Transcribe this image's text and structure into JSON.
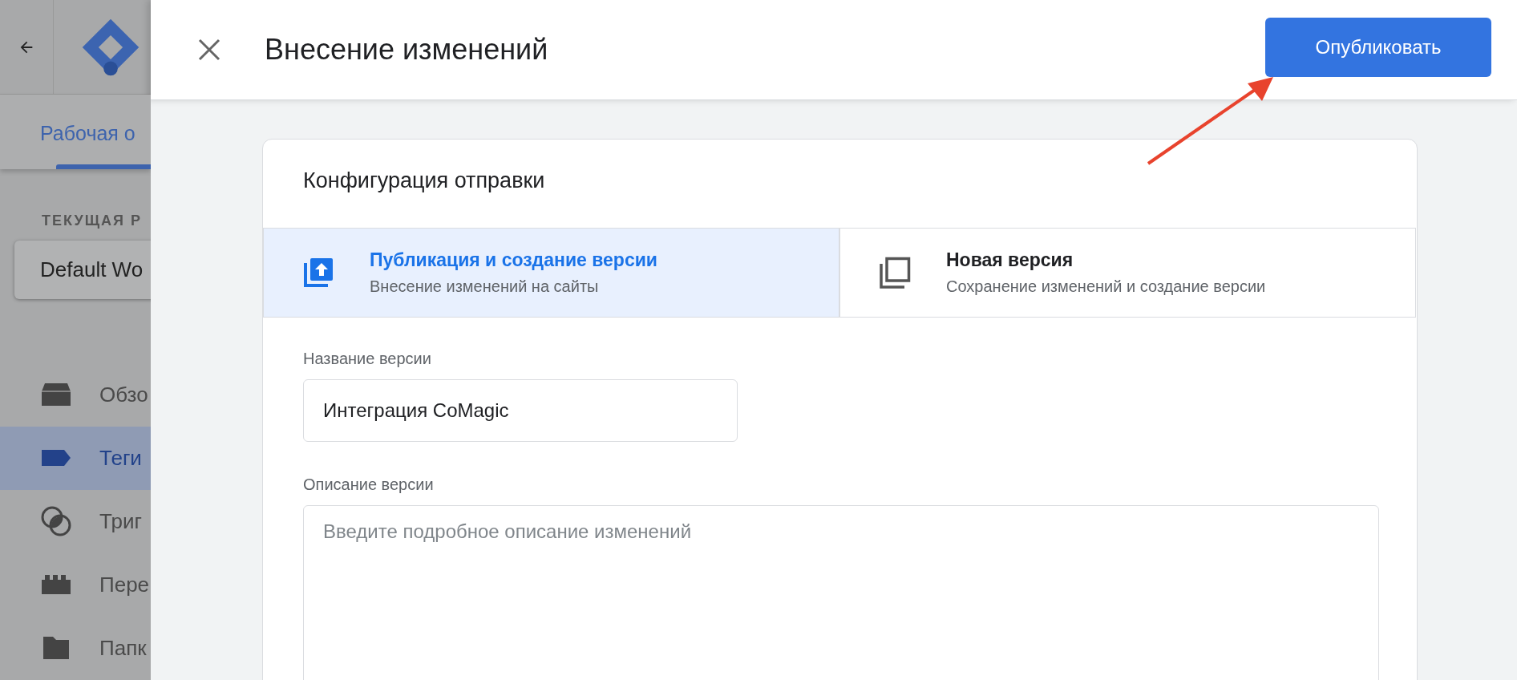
{
  "sidebar": {
    "tab": "Рабочая о",
    "section_label": "ТЕКУЩАЯ Р",
    "workspace": "Default Wo",
    "items": [
      {
        "kind": "overview",
        "label": "Обзо",
        "selected": false
      },
      {
        "kind": "tags",
        "label": "Теги",
        "selected": true
      },
      {
        "kind": "triggers",
        "label": "Триг",
        "selected": false
      },
      {
        "kind": "variables",
        "label": "Пере",
        "selected": false
      },
      {
        "kind": "folders",
        "label": "Папк",
        "selected": false
      }
    ]
  },
  "dialog": {
    "title": "Внесение изменений",
    "publish_button": "Опубликовать",
    "card_title": "Конфигурация отправки",
    "options": [
      {
        "kind": "publish",
        "title": "Публикация и создание версии",
        "subtitle": "Внесение изменений на сайты",
        "selected": true
      },
      {
        "kind": "version",
        "title": "Новая версия",
        "subtitle": "Сохранение изменений и создание версии",
        "selected": false
      }
    ],
    "version_name": {
      "label": "Название версии",
      "value": "Интеграция CoMagic"
    },
    "version_description": {
      "label": "Описание версии",
      "placeholder": "Введите подробное описание изменений"
    }
  }
}
